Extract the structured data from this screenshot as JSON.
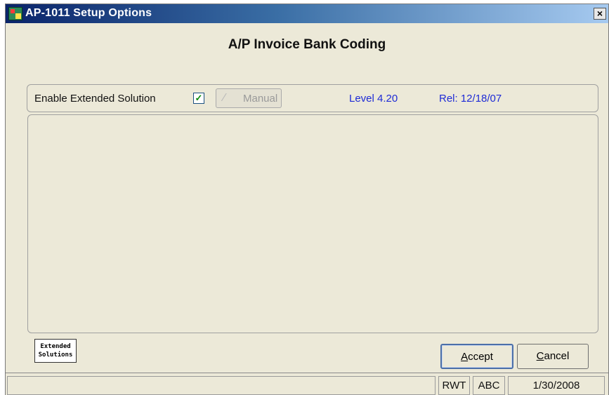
{
  "window": {
    "title": "AP-1011 Setup Options",
    "close_label": "×"
  },
  "heading": "A/P Invoice Bank Coding",
  "options": {
    "enable_label": "Enable Extended Solution",
    "enable_checked": true,
    "checkbox_mark": "✓",
    "manual_icon": "pencil-icon",
    "manual_pen_glyph": "⁄",
    "manual_label": "Manual",
    "level": "Level 4.20",
    "rel": "Rel: 12/18/07"
  },
  "logo": {
    "line1": "Extended",
    "line2": "Solutions"
  },
  "buttons": {
    "accept_underline": "A",
    "accept_rest": "ccept",
    "cancel_underline": "C",
    "cancel_rest": "ancel"
  },
  "status": {
    "main": "",
    "user": "RWT",
    "company": "ABC",
    "date": "1/30/2008"
  },
  "colors": {
    "title_gradient_start": "#0a246a",
    "link_blue": "#1e2bd6",
    "window_bg": "#ece9d8"
  }
}
